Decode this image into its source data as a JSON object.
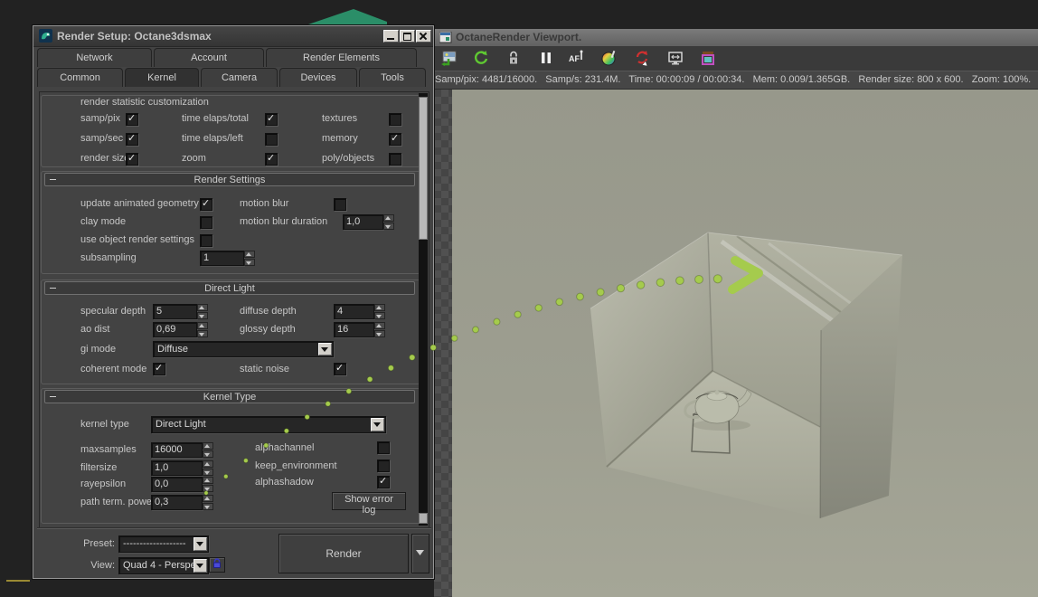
{
  "dialog": {
    "title": "Render Setup: Octane3dsmax",
    "tabs_row1": [
      {
        "label": "Network"
      },
      {
        "label": "Account"
      },
      {
        "label": "Render Elements"
      }
    ],
    "tabs_row2": [
      {
        "label": "Common"
      },
      {
        "label": "Kernel"
      },
      {
        "label": "Camera"
      },
      {
        "label": "Devices"
      },
      {
        "label": "Tools"
      }
    ],
    "active_tab": "Kernel",
    "stat_custom": {
      "title": "render statistic customization",
      "checks": [
        {
          "label": "samp/pix",
          "checked": true
        },
        {
          "label": "time elaps/total",
          "checked": true
        },
        {
          "label": "textures",
          "checked": false
        },
        {
          "label": "samp/sec",
          "checked": true
        },
        {
          "label": "time elaps/left",
          "checked": false
        },
        {
          "label": "memory",
          "checked": true
        },
        {
          "label": "render size",
          "checked": true
        },
        {
          "label": "zoom",
          "checked": true
        },
        {
          "label": "poly/objects",
          "checked": false
        }
      ]
    },
    "render_settings": {
      "title": "Render Settings",
      "update_animated_geometry": {
        "label": "update animated geometry",
        "checked": true
      },
      "motion_blur": {
        "label": "motion blur",
        "checked": false
      },
      "clay_mode": {
        "label": "clay mode",
        "checked": false
      },
      "motion_blur_duration": {
        "label": "motion blur duration",
        "value": "1,0"
      },
      "use_object_render_settings": {
        "label": "use object render settings",
        "checked": false
      },
      "subsampling": {
        "label": "subsampling",
        "value": "1"
      }
    },
    "direct_light": {
      "title": "Direct Light",
      "specular_depth": {
        "label": "specular depth",
        "value": "5"
      },
      "diffuse_depth": {
        "label": "diffuse depth",
        "value": "4"
      },
      "ao_dist": {
        "label": "ao dist",
        "value": "0,69"
      },
      "glossy_depth": {
        "label": "glossy depth",
        "value": "16"
      },
      "gi_mode": {
        "label": "gi mode",
        "value": "Diffuse"
      },
      "coherent_mode": {
        "label": "coherent mode",
        "checked": true
      },
      "static_noise": {
        "label": "static noise",
        "checked": true
      }
    },
    "kernel_type": {
      "title": "Kernel Type",
      "kernel_type": {
        "label": "kernel type",
        "value": "Direct Light"
      },
      "maxsamples": {
        "label": "maxsamples",
        "value": "16000"
      },
      "filtersize": {
        "label": "filtersize",
        "value": "1,0"
      },
      "rayepsilon": {
        "label": "rayepsilon",
        "value": "0,0"
      },
      "path_term_power": {
        "label": "path term. power",
        "value": "0,3"
      },
      "alphachannel": {
        "label": "alphachannel",
        "checked": false
      },
      "keep_environment": {
        "label": "keep_environment",
        "checked": false
      },
      "alphashadow": {
        "label": "alphashadow",
        "checked": true
      },
      "show_error_log": {
        "label": "Show error log"
      }
    },
    "footer": {
      "preset_label": "Preset:",
      "preset_value": "-------------------",
      "view_label": "View:",
      "view_value": "Quad 4 - Perspe",
      "render_button": "Render"
    }
  },
  "viewport": {
    "title": "OctaneRender Viewport.",
    "toolbar_icons": [
      "save-image-icon",
      "refresh-icon",
      "lock-icon",
      "pause-icon",
      "autofocus-icon",
      "color-picker-icon",
      "reset-view-icon",
      "fit-window-icon",
      "render-target-icon"
    ],
    "stats": "Samp/pix: 4481/16000.   Samp/s: 231.4M.   Time: 00:00:09 / 00:00:34.   Mem: 0.009/1.365GB.   Render size: 800 x 600.   Zoom: 100%."
  },
  "colors": {
    "accent_green": "#a5cb4d",
    "viewport_bg": "#9d9e8f",
    "ui_gray": "#434343"
  }
}
